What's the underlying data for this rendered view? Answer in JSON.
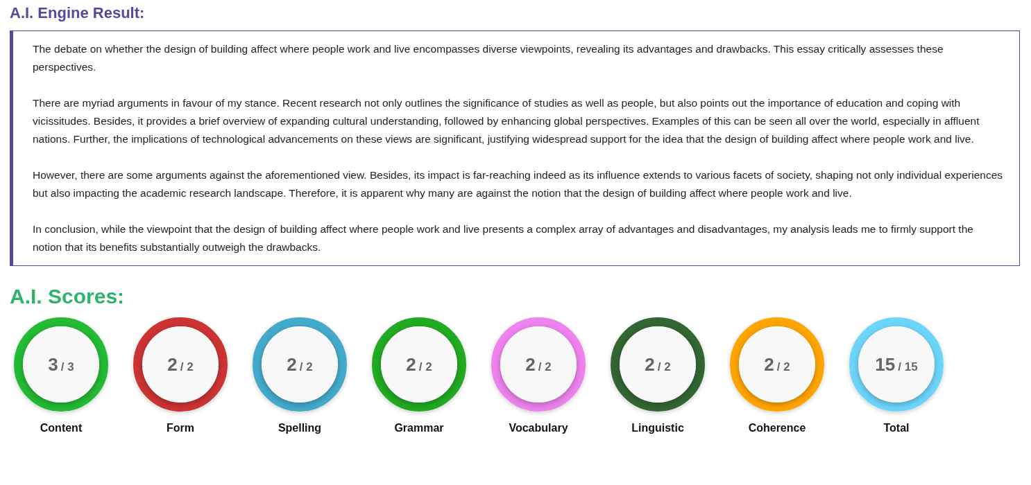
{
  "result": {
    "title": "A.I. Engine Result:",
    "paragraphs": [
      "The debate on whether the design of building affect where people work and live encompasses diverse viewpoints, revealing its advantages and drawbacks. This essay critically assesses these perspectives.",
      "There are myriad arguments in favour of my stance. Recent research not only outlines the significance of studies as well as people, but also points out the importance of education and coping with vicissitudes. Besides, it provides a brief overview of expanding cultural understanding, followed by enhancing global perspectives. Examples of this can be seen all over the world, especially in affluent nations. Further, the implications of technological advancements on these views are significant, justifying widespread support for the idea that the design of building affect where people work and live.",
      "However, there are some arguments against the aforementioned view. Besides, its impact is far-reaching indeed as its influence extends to various facets of society, shaping not only individual experiences but also impacting the academic research landscape. Therefore, it is apparent why many are against the notion that the design of building affect where people work and live.",
      "In conclusion, while the viewpoint that the design of building affect where people work and live presents a complex array of advantages and disadvantages, my analysis leads me to firmly support the notion that its benefits substantially outweigh the drawbacks."
    ]
  },
  "scores": {
    "title": "A.I. Scores:",
    "items": [
      {
        "label": "Content",
        "score": "3",
        "max": "/ 3",
        "color": "#22bb33"
      },
      {
        "label": "Form",
        "score": "2",
        "max": "/ 2",
        "color": "#cc3333"
      },
      {
        "label": "Spelling",
        "score": "2",
        "max": "/ 2",
        "color": "#44aacc"
      },
      {
        "label": "Grammar",
        "score": "2",
        "max": "/ 2",
        "color": "#22aa22"
      },
      {
        "label": "Vocabulary",
        "score": "2",
        "max": "/ 2",
        "color": "#ee82ee"
      },
      {
        "label": "Linguistic",
        "score": "2",
        "max": "/ 2",
        "color": "#336633"
      },
      {
        "label": "Coherence",
        "score": "2",
        "max": "/ 2",
        "color": "#ffa500"
      },
      {
        "label": "Total",
        "score": "15",
        "max": "/ 15",
        "color": "#6dd5fa"
      }
    ]
  }
}
